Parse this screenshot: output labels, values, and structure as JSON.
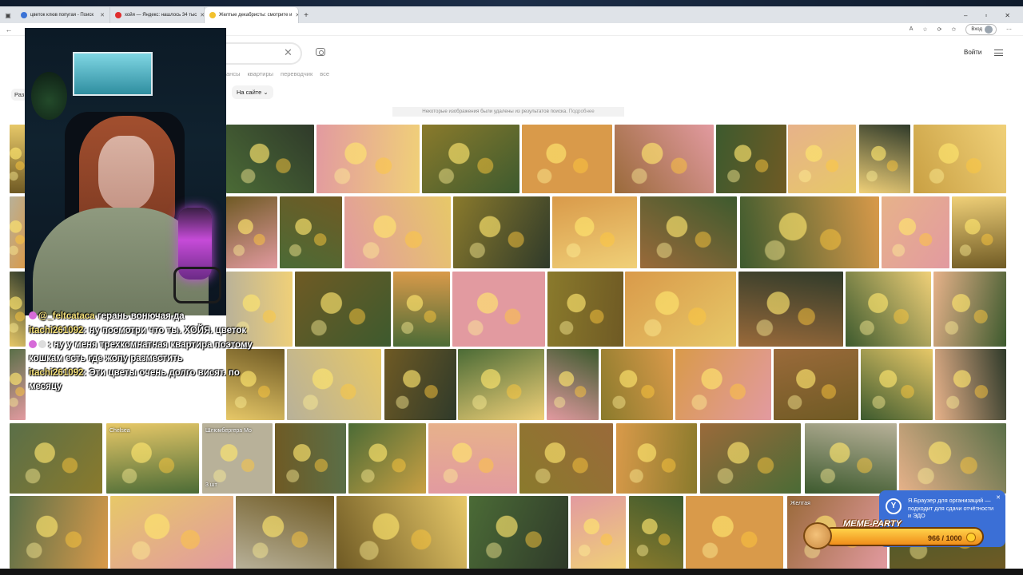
{
  "browser": {
    "tabs": [
      {
        "title": "цветок клюв попугая - Поиск",
        "icon_color": "#3b73d6"
      },
      {
        "title": "хойя — Яндекс: нашлось 34 тыс",
        "icon_color": "#e02e2e"
      },
      {
        "title": "Желтые декабристы: смотрите и",
        "icon_color": "#f2c12e",
        "active": true
      }
    ],
    "new_tab": "+",
    "window_controls": [
      "–",
      "▫",
      "✕"
    ],
    "login_pill": "Вход"
  },
  "search": {
    "nav_links": [
      "ансы",
      "квартиры",
      "переводчик",
      "все"
    ],
    "enter_button": "Войти",
    "filter_left": "Раз",
    "filter_site": "На сайте",
    "notice": "Некоторые изображения были удалены из результатов поиска.",
    "notice_more": "Подробнее"
  },
  "results": {
    "tile_labels": [
      "Chelsea",
      "Шлюмбергера Мо",
      "3 шт",
      "Желтая"
    ]
  },
  "chat": [
    {
      "user": "@_feltcataca",
      "text": "герань вонючая да"
    },
    {
      "user": "itachi261092",
      "text": "ну посмотри что ты. ХОЙЯ. цветок"
    },
    {
      "user": "",
      "text": "ну у меня трехкомнатная квартира поэтому кошкам есть где жопу разместить"
    },
    {
      "user": "itachi261092",
      "text": "Эти цветы очень долго висят. по месяцу"
    }
  ],
  "popup": {
    "text": "Я.Браузер для организаций — подходит для сдачи отчётности и ЭДО",
    "logo": "Y",
    "close": "✕"
  },
  "meme_party": {
    "title": "MEME-PARTY",
    "progress": "966 / 1000",
    "progress_fraction": 0.966
  }
}
